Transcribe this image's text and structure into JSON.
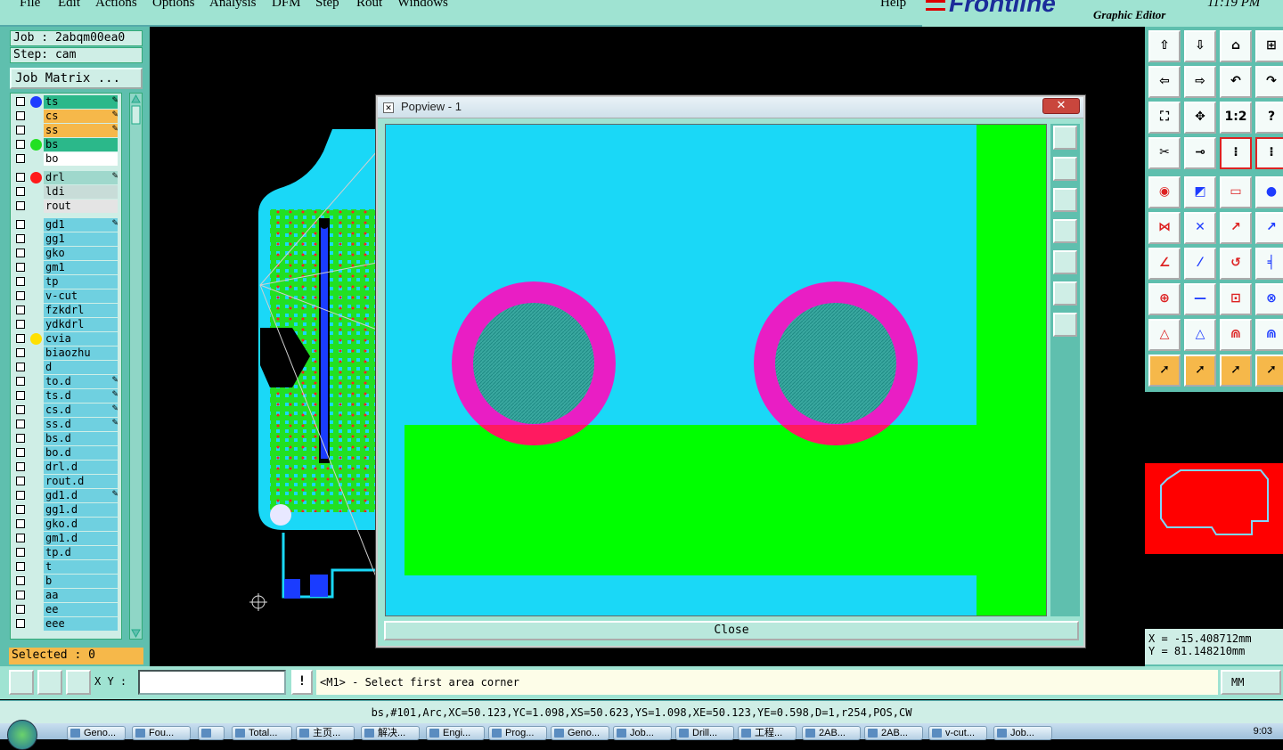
{
  "menu": [
    "File",
    "Edit",
    "Actions",
    "Options",
    "Analysis",
    "DFM",
    "Step",
    "Rout",
    "Windows"
  ],
  "menu_help": "Help",
  "brand": {
    "logo": "Frontline",
    "subtitle": "Graphic Editor",
    "time": "11:19 PM"
  },
  "job": {
    "job_label": "Job : 2abqm00ea0",
    "step_label": "Step: cam",
    "matrix_button": "Job Matrix ..."
  },
  "layers": [
    {
      "name": "ts",
      "bg": "#2bb88a",
      "dot": "#1e3cff",
      "edit": true
    },
    {
      "name": "cs",
      "bg": "#f6b84a",
      "dot": "",
      "edit": true
    },
    {
      "name": "ss",
      "bg": "#f6b84a",
      "dot": "",
      "edit": true
    },
    {
      "name": "bs",
      "bg": "#2bb88a",
      "dot": "#22e022",
      "edit": false
    },
    {
      "name": "bo",
      "bg": "#ffffff",
      "dot": "",
      "edit": false
    },
    {
      "name": "drl",
      "bg": "#9fd8cc",
      "dot": "#ff1a1a",
      "edit": true
    },
    {
      "name": "ldi",
      "bg": "#c8dcd8",
      "dot": "",
      "edit": false
    },
    {
      "name": "rout",
      "bg": "#e4e4e4",
      "dot": "",
      "edit": false
    },
    {
      "name": "gd1",
      "bg": "#6fd0e0",
      "dot": "",
      "edit": true
    },
    {
      "name": "gg1",
      "bg": "#6fd0e0",
      "dot": "",
      "edit": false
    },
    {
      "name": "gko",
      "bg": "#6fd0e0",
      "dot": "",
      "edit": false
    },
    {
      "name": "gm1",
      "bg": "#6fd0e0",
      "dot": "",
      "edit": false
    },
    {
      "name": "tp",
      "bg": "#6fd0e0",
      "dot": "",
      "edit": false
    },
    {
      "name": "v-cut",
      "bg": "#6fd0e0",
      "dot": "",
      "edit": false
    },
    {
      "name": "fzkdrl",
      "bg": "#6fd0e0",
      "dot": "",
      "edit": false
    },
    {
      "name": "ydkdrl",
      "bg": "#6fd0e0",
      "dot": "",
      "edit": false
    },
    {
      "name": "cvia",
      "bg": "#6fd0e0",
      "dot": "#ffe000",
      "edit": false
    },
    {
      "name": "biaozhu",
      "bg": "#6fd0e0",
      "dot": "",
      "edit": false
    },
    {
      "name": "d",
      "bg": "#6fd0e0",
      "dot": "",
      "edit": false
    },
    {
      "name": "to.d",
      "bg": "#6fd0e0",
      "dot": "",
      "edit": true
    },
    {
      "name": "ts.d",
      "bg": "#6fd0e0",
      "dot": "",
      "edit": true
    },
    {
      "name": "cs.d",
      "bg": "#6fd0e0",
      "dot": "",
      "edit": true
    },
    {
      "name": "ss.d",
      "bg": "#6fd0e0",
      "dot": "",
      "edit": true
    },
    {
      "name": "bs.d",
      "bg": "#6fd0e0",
      "dot": "",
      "edit": false
    },
    {
      "name": "bo.d",
      "bg": "#6fd0e0",
      "dot": "",
      "edit": false
    },
    {
      "name": "drl.d",
      "bg": "#6fd0e0",
      "dot": "",
      "edit": false
    },
    {
      "name": "rout.d",
      "bg": "#6fd0e0",
      "dot": "",
      "edit": false
    },
    {
      "name": "gd1.d",
      "bg": "#6fd0e0",
      "dot": "",
      "edit": true
    },
    {
      "name": "gg1.d",
      "bg": "#6fd0e0",
      "dot": "",
      "edit": false
    },
    {
      "name": "gko.d",
      "bg": "#6fd0e0",
      "dot": "",
      "edit": false
    },
    {
      "name": "gm1.d",
      "bg": "#6fd0e0",
      "dot": "",
      "edit": false
    },
    {
      "name": "tp.d",
      "bg": "#6fd0e0",
      "dot": "",
      "edit": false
    },
    {
      "name": "t",
      "bg": "#6fd0e0",
      "dot": "",
      "edit": false
    },
    {
      "name": "b",
      "bg": "#6fd0e0",
      "dot": "",
      "edit": false
    },
    {
      "name": "aa",
      "bg": "#6fd0e0",
      "dot": "",
      "edit": false
    },
    {
      "name": "ee",
      "bg": "#6fd0e0",
      "dot": "",
      "edit": false
    },
    {
      "name": "eee",
      "bg": "#6fd0e0",
      "dot": "",
      "edit": false
    }
  ],
  "selected_label": "Selected : 0",
  "popup": {
    "title": "Popview - 1",
    "close_x": "✕",
    "close_button": "Close"
  },
  "colors": {
    "copper": "#00ff00",
    "substrate": "#1ad8f7",
    "soldermask_ring": "#e91ec4",
    "overlap": "#ff1a60",
    "drill": "#3aa8a0",
    "minimap": "#ff0000"
  },
  "coords": {
    "x": "X = -15.408712mm",
    "y": "Y = 81.148210mm"
  },
  "cmd": {
    "xy_label": "X Y :",
    "xy_value": "",
    "bang": "!",
    "prompt": "<M1> - Select first area corner",
    "units": "MM"
  },
  "status_line": "bs,#101,Arc,XC=50.123,YC=1.098,XS=50.623,YS=1.098,XE=50.123,YE=0.598,D=1,r254,POS,CW",
  "taskbar": {
    "items": [
      "Geno...",
      "Fou...",
      "",
      "Total...",
      "主页...",
      "解决...",
      "Engi...",
      "Prog...",
      "Geno...",
      "Job...",
      "Drill...",
      "工程...",
      "2AB...",
      "2AB...",
      "v-cut...",
      "Job..."
    ],
    "clock": "9:03"
  }
}
